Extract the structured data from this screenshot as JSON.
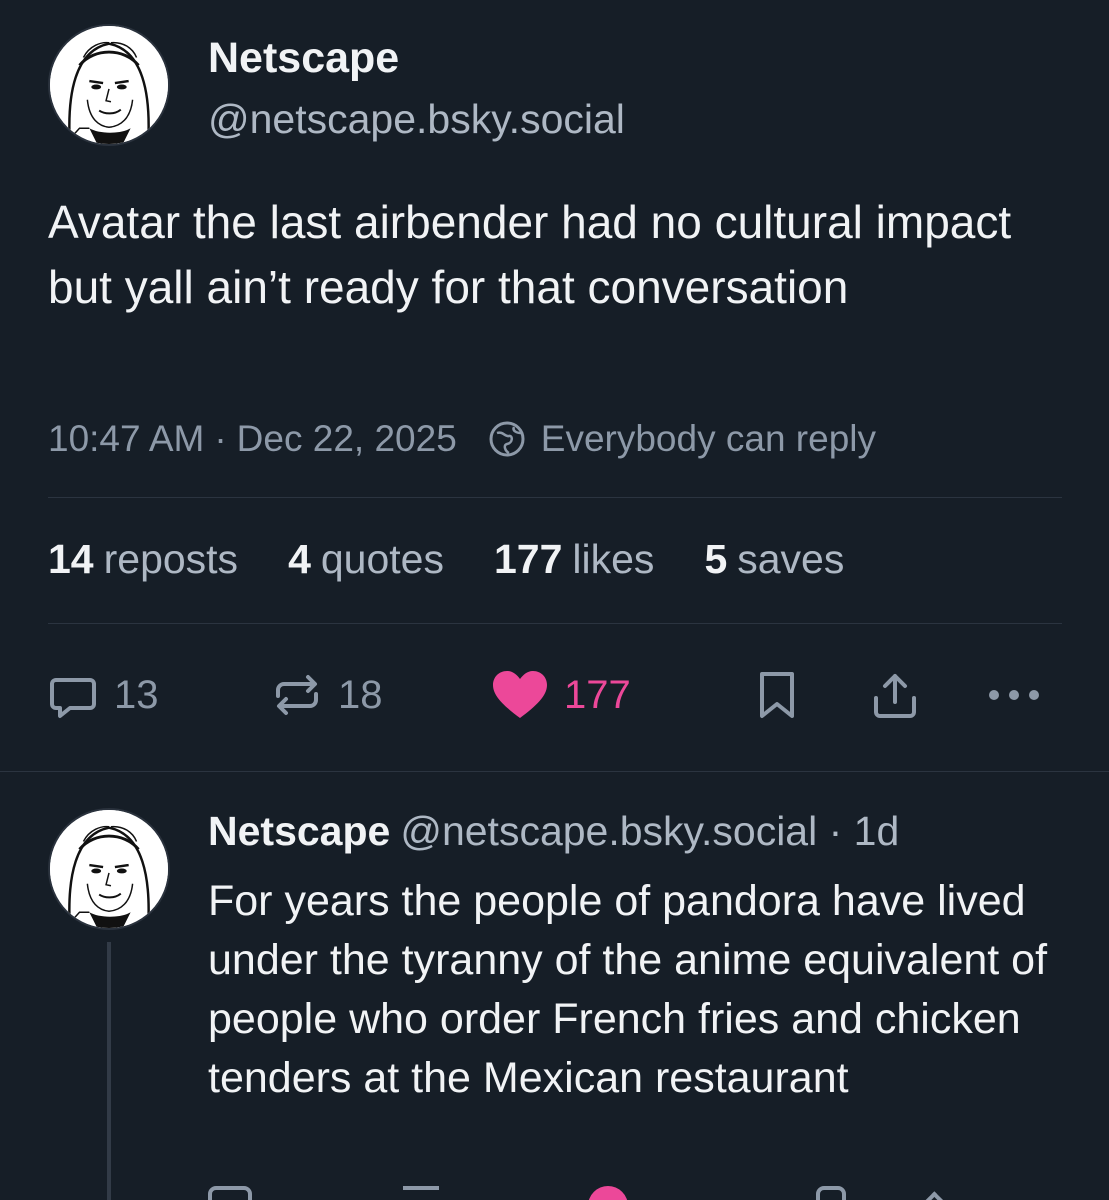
{
  "post": {
    "author": {
      "display_name": "Netscape",
      "handle": "@netscape.bsky.social",
      "avatar_icon": "illustrated-woman-avatar"
    },
    "text": "Avatar the last airbender had no cultural impact but yall ain’t ready for that conversation",
    "time": "10:47 AM",
    "separator": "·",
    "date": "Dec 22, 2025",
    "reply_setting": "Everybody can reply",
    "reply_setting_icon": "globe-icon",
    "stats": [
      {
        "count": "14",
        "label": "reposts"
      },
      {
        "count": "4",
        "label": "quotes"
      },
      {
        "count": "177",
        "label": "likes"
      },
      {
        "count": "5",
        "label": "saves"
      }
    ],
    "actions": {
      "reply_count": "13",
      "repost_count": "18",
      "like_count": "177",
      "liked": true
    }
  },
  "reply": {
    "display_name": "Netscape",
    "handle": "@netscape.bsky.social",
    "time_sep": " · ",
    "time_ago": "1d",
    "text": "For years the people of pandora have lived under the tyranny of the anime equivalent of people who order French fries and chicken tenders at the Mexican restaurant"
  },
  "colors": {
    "background": "#161e27",
    "primary_text": "#f1f3f5",
    "secondary_text": "#aeb8c4",
    "muted_text": "#8d99a8",
    "like_accent": "#ec4899",
    "divider": "#2b3440"
  }
}
